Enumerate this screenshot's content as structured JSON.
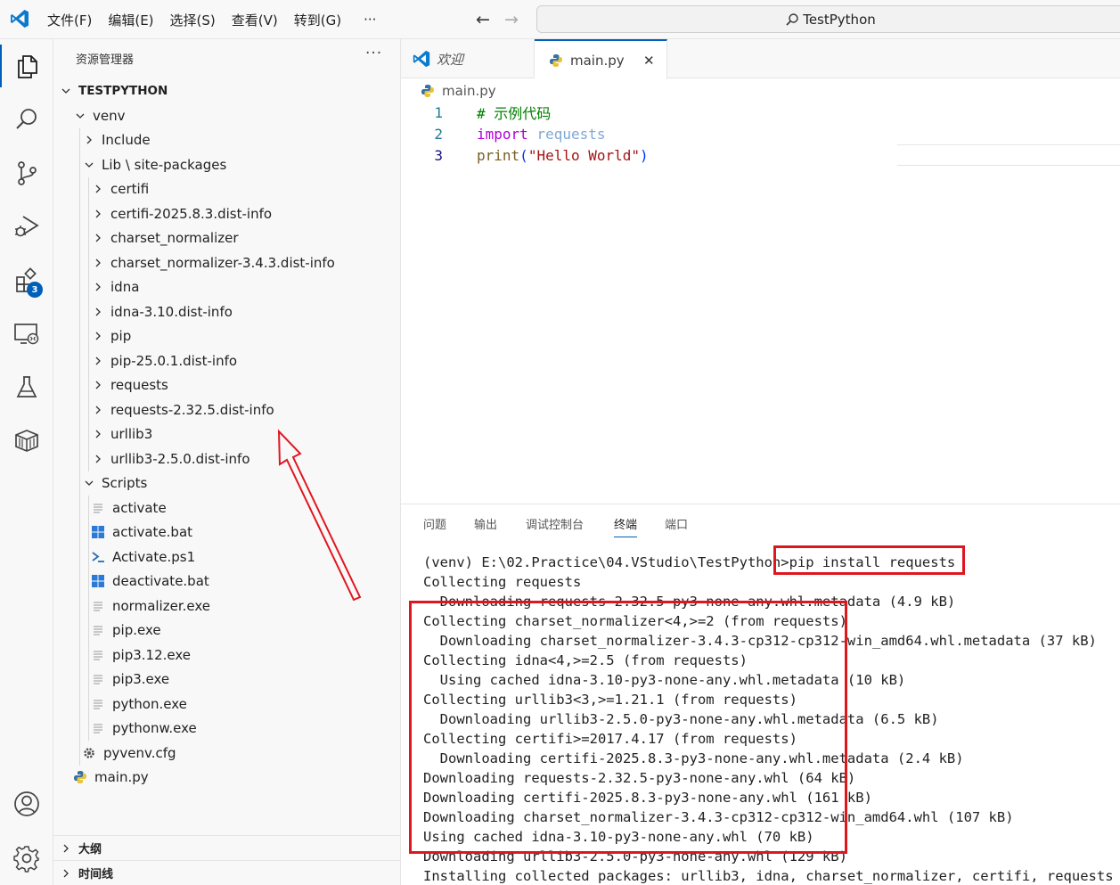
{
  "titlebar": {
    "menus": [
      "文件(F)",
      "编辑(E)",
      "选择(S)",
      "查看(V)",
      "转到(G)"
    ],
    "more": "···",
    "back": "←",
    "forward": "→",
    "search_text": "TestPython"
  },
  "activitybar": {
    "items": [
      "explorer-icon",
      "search-icon",
      "source-control-icon",
      "run-debug-icon",
      "extensions-icon",
      "remote-explorer-icon",
      "testing-icon",
      "package-icon"
    ],
    "extensions_badge": "3",
    "bottom": [
      "account-icon",
      "settings-gear-icon"
    ]
  },
  "sidebar": {
    "title": "资源管理器",
    "more": "···",
    "root": "TESTPYTHON",
    "tree": [
      {
        "label": "venv",
        "kind": "folder-open",
        "depth": 1
      },
      {
        "label": "Include",
        "kind": "folder",
        "depth": 2
      },
      {
        "label": "Lib \\ site-packages",
        "kind": "folder-open",
        "depth": 2
      },
      {
        "label": "certifi",
        "kind": "folder",
        "depth": 3
      },
      {
        "label": "certifi-2025.8.3.dist-info",
        "kind": "folder",
        "depth": 3
      },
      {
        "label": "charset_normalizer",
        "kind": "folder",
        "depth": 3
      },
      {
        "label": "charset_normalizer-3.4.3.dist-info",
        "kind": "folder",
        "depth": 3
      },
      {
        "label": "idna",
        "kind": "folder",
        "depth": 3
      },
      {
        "label": "idna-3.10.dist-info",
        "kind": "folder",
        "depth": 3
      },
      {
        "label": "pip",
        "kind": "folder",
        "depth": 3
      },
      {
        "label": "pip-25.0.1.dist-info",
        "kind": "folder",
        "depth": 3
      },
      {
        "label": "requests",
        "kind": "folder",
        "depth": 3
      },
      {
        "label": "requests-2.32.5.dist-info",
        "kind": "folder",
        "depth": 3
      },
      {
        "label": "urllib3",
        "kind": "folder",
        "depth": 3
      },
      {
        "label": "urllib3-2.5.0.dist-info",
        "kind": "folder",
        "depth": 3
      },
      {
        "label": "Scripts",
        "kind": "folder-open",
        "depth": 2
      },
      {
        "label": "activate",
        "kind": "text",
        "depth": 3
      },
      {
        "label": "activate.bat",
        "kind": "windows",
        "depth": 3
      },
      {
        "label": "Activate.ps1",
        "kind": "powershell",
        "depth": 3
      },
      {
        "label": "deactivate.bat",
        "kind": "windows",
        "depth": 3
      },
      {
        "label": "normalizer.exe",
        "kind": "text",
        "depth": 3
      },
      {
        "label": "pip.exe",
        "kind": "text",
        "depth": 3
      },
      {
        "label": "pip3.12.exe",
        "kind": "text",
        "depth": 3
      },
      {
        "label": "pip3.exe",
        "kind": "text",
        "depth": 3
      },
      {
        "label": "python.exe",
        "kind": "text",
        "depth": 3
      },
      {
        "label": "pythonw.exe",
        "kind": "text",
        "depth": 3
      },
      {
        "label": "pyvenv.cfg",
        "kind": "gear",
        "depth": 2
      },
      {
        "label": "main.py",
        "kind": "python",
        "depth": 1
      }
    ],
    "outline": "大纲",
    "timeline": "时间线"
  },
  "editor": {
    "tabs": [
      {
        "label": "欢迎",
        "icon": "vscode-icon"
      },
      {
        "label": "main.py",
        "icon": "python-icon",
        "close": "✕"
      }
    ],
    "breadcrumb": "main.py",
    "lines": [
      {
        "num": "1",
        "tokens": [
          {
            "t": "# 示例代码",
            "c": "#008000"
          }
        ]
      },
      {
        "num": "2",
        "tokens": [
          {
            "t": "import",
            "c": "#af00db"
          },
          {
            "t": " ",
            "c": "#000000"
          },
          {
            "t": "requests",
            "c": "#7fa8d6"
          }
        ]
      },
      {
        "num": "3",
        "tokens": [
          {
            "t": "print",
            "c": "#795e26"
          },
          {
            "t": "(",
            "c": "#0431fa"
          },
          {
            "t": "\"Hello World\"",
            "c": "#a31515"
          },
          {
            "t": ")",
            "c": "#0431fa"
          }
        ]
      }
    ]
  },
  "panel": {
    "tabs": [
      "问题",
      "输出",
      "调试控制台",
      "终端",
      "端口"
    ],
    "active_tab": "终端",
    "terminal_lines": [
      "(venv) E:\\02.Practice\\04.VStudio\\TestPython>pip install requests",
      "Collecting requests",
      "  Downloading requests-2.32.5-py3-none-any.whl.metadata (4.9 kB)",
      "Collecting charset_normalizer<4,>=2 (from requests)",
      "  Downloading charset_normalizer-3.4.3-cp312-cp312-win_amd64.whl.metadata (37 kB)",
      "Collecting idna<4,>=2.5 (from requests)",
      "  Using cached idna-3.10-py3-none-any.whl.metadata (10 kB)",
      "Collecting urllib3<3,>=1.21.1 (from requests)",
      "  Downloading urllib3-2.5.0-py3-none-any.whl.metadata (6.5 kB)",
      "Collecting certifi>=2017.4.17 (from requests)",
      "  Downloading certifi-2025.8.3-py3-none-any.whl.metadata (2.4 kB)",
      "Downloading requests-2.32.5-py3-none-any.whl (64 kB)",
      "Downloading certifi-2025.8.3-py3-none-any.whl (161 kB)",
      "Downloading charset_normalizer-3.4.3-cp312-cp312-win_amd64.whl (107 kB)",
      "Using cached idna-3.10-py3-none-any.whl (70 kB)",
      "Downloading urllib3-2.5.0-py3-none-any.whl (129 kB)",
      "Installing collected packages: urllib3, idna, charset_normalizer, certifi, requests"
    ]
  },
  "colors": {
    "accent": "#005fb8",
    "annotation_red": "#e0161f"
  }
}
